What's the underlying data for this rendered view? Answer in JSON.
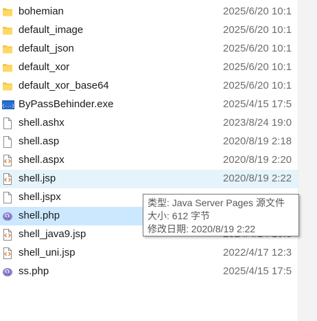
{
  "files": [
    {
      "name": "bohemian",
      "date": "2025/6/20 10:1",
      "icon": "folder-icon",
      "state": ""
    },
    {
      "name": "default_image",
      "date": "2025/6/20 10:1",
      "icon": "folder-icon",
      "state": ""
    },
    {
      "name": "default_json",
      "date": "2025/6/20 10:1",
      "icon": "folder-icon",
      "state": ""
    },
    {
      "name": "default_xor",
      "date": "2025/6/20 10:1",
      "icon": "folder-icon",
      "state": ""
    },
    {
      "name": "default_xor_base64",
      "date": "2025/6/20 10:1",
      "icon": "folder-icon",
      "state": ""
    },
    {
      "name": "ByPassBehinder.exe",
      "date": "2025/4/15 17:5",
      "icon": "exe-icon",
      "state": ""
    },
    {
      "name": "shell.ashx",
      "date": "2023/8/24 19:0",
      "icon": "blank-file-icon",
      "state": ""
    },
    {
      "name": "shell.asp",
      "date": "2020/8/19 2:18",
      "icon": "blank-file-icon",
      "state": ""
    },
    {
      "name": "shell.aspx",
      "date": "2020/8/19 2:20",
      "icon": "code-file-icon",
      "state": ""
    },
    {
      "name": "shell.jsp",
      "date": "2020/8/19 2:22",
      "icon": "code-file-icon",
      "state": "hover"
    },
    {
      "name": "shell.jspx",
      "date": "",
      "icon": "blank-file-icon",
      "state": ""
    },
    {
      "name": "shell.php",
      "date": "",
      "icon": "php-file-icon",
      "state": "selected"
    },
    {
      "name": "shell_java9.jsp",
      "date": "2024/4/14 10:3",
      "icon": "code-file-icon",
      "state": ""
    },
    {
      "name": "shell_uni.jsp",
      "date": "2022/4/17 12:3",
      "icon": "code-file-icon",
      "state": ""
    },
    {
      "name": "ss.php",
      "date": "2025/4/15 17:5",
      "icon": "php-file-icon",
      "state": ""
    }
  ],
  "tooltip": {
    "type_line": "类型: Java Server Pages 源文件",
    "size_line": "大小: 612 字节",
    "modified_line": "修改日期: 2020/8/19 2:22"
  },
  "colors": {
    "hover": "#e5f3fb",
    "selected": "#cce8ff",
    "folder": "#f4c54a"
  }
}
